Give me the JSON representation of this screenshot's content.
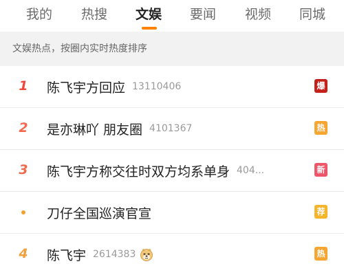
{
  "tabs": [
    {
      "label": "我的",
      "active": false
    },
    {
      "label": "热搜",
      "active": false
    },
    {
      "label": "文娱",
      "active": true
    },
    {
      "label": "要闻",
      "active": false
    },
    {
      "label": "视频",
      "active": false
    },
    {
      "label": "同城",
      "active": false
    }
  ],
  "accent_color": "#ff8200",
  "subtitle": "文娱热点，按圈内实时热度排序",
  "hot_list": [
    {
      "rank": "1",
      "topic": "陈飞宇方回应",
      "count": "13110406",
      "icon": "",
      "badge": "爆",
      "badge_color": "#c4211a"
    },
    {
      "rank": "2",
      "topic": "是亦琳吖 朋友圈",
      "count": "4101367",
      "icon": "",
      "badge": "热",
      "badge_color": "#f7a531"
    },
    {
      "rank": "3",
      "topic": "陈飞宇方称交往时双方均系单身",
      "count": "404...",
      "icon": "",
      "badge": "新",
      "badge_color": "#ee5569"
    },
    {
      "rank": "",
      "topic": "刀仔全国巡演官宣",
      "count": "",
      "icon": "",
      "badge": "荐",
      "badge_color": "#f5b42a"
    },
    {
      "rank": "4",
      "topic": "陈飞宇",
      "count": "2614383",
      "icon": "doge-emoji-icon",
      "badge": "热",
      "badge_color": "#f7a531"
    }
  ]
}
